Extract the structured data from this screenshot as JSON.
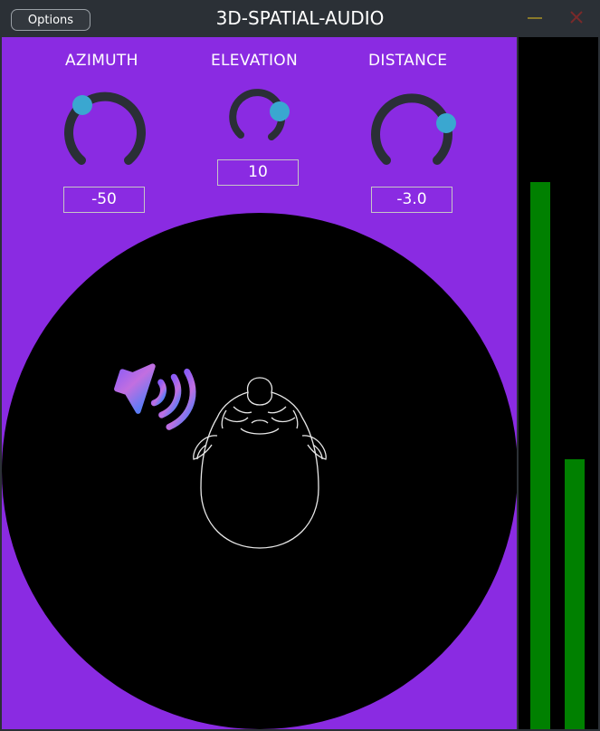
{
  "window": {
    "title": "3D-SPATIAL-AUDIO",
    "options_label": "Options",
    "minimize_icon": "minimize-icon",
    "close_icon": "close-icon"
  },
  "knobs": [
    {
      "label": "AZIMUTH",
      "value": "-50"
    },
    {
      "label": "ELEVATION",
      "value": "10"
    },
    {
      "label": "DISTANCE",
      "value": "-3.0"
    }
  ],
  "stage": {
    "speaker_icon": "speaker-icon",
    "head_icon": "listener-head-icon"
  },
  "meters": {
    "left_level": 0.79,
    "right_level": 0.39,
    "color": "#008000"
  },
  "colors": {
    "panel": "#8a2be2",
    "knob_track": "#2a2f36",
    "knob_thumb": "#3aa7d0",
    "titlebar": "#2b3036"
  }
}
